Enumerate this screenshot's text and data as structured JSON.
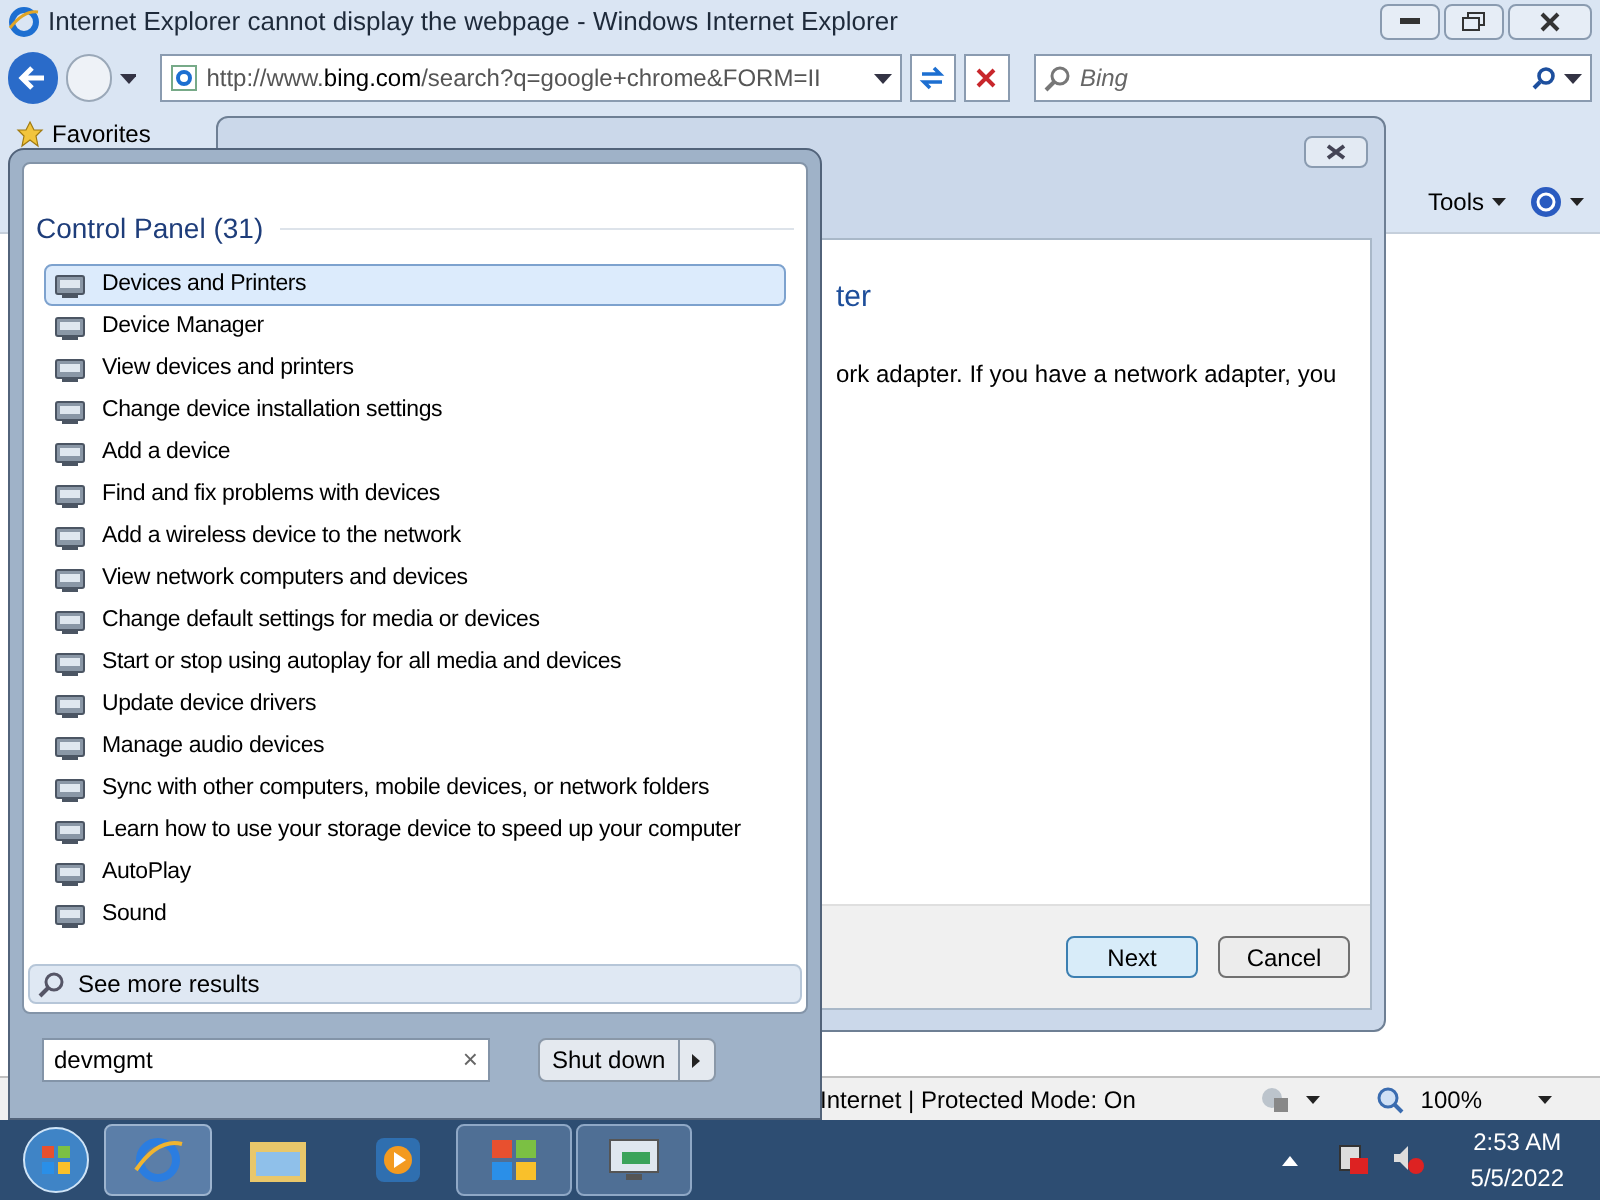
{
  "window": {
    "title": "Internet Explorer cannot display the webpage - Windows Internet Explorer"
  },
  "address_bar": {
    "url_prefix": "http://www.",
    "url_domain": "bing.com",
    "url_rest": "/search?q=google+chrome&FORM=II"
  },
  "search_box": {
    "placeholder": "Bing"
  },
  "favorites_bar": {
    "label": "Favorites"
  },
  "command_bar": {
    "tools": "Tools"
  },
  "dialog": {
    "heading": "ter",
    "text": "ork adapter. If you have a network adapter, you",
    "buttons": [
      {
        "label": "Next",
        "default": true
      },
      {
        "label": "Cancel",
        "default": false
      }
    ]
  },
  "status_bar": {
    "zone": "Internet | Protected Mode: On",
    "zoom": "100%"
  },
  "start_menu": {
    "group": "Control Panel (31)",
    "results": [
      {
        "label": "Devices and Printers",
        "selected": true
      },
      {
        "label": "Device Manager",
        "selected": false
      },
      {
        "label": "View devices and printers",
        "selected": false
      },
      {
        "label": "Change device installation settings",
        "selected": false
      },
      {
        "label": "Add a device",
        "selected": false
      },
      {
        "label": "Find and fix problems with devices",
        "selected": false
      },
      {
        "label": "Add a wireless device to the network",
        "selected": false
      },
      {
        "label": "View network computers and devices",
        "selected": false
      },
      {
        "label": "Change default settings for media or devices",
        "selected": false
      },
      {
        "label": "Start or stop using autoplay for all media and devices",
        "selected": false
      },
      {
        "label": "Update device drivers",
        "selected": false
      },
      {
        "label": "Manage audio devices",
        "selected": false
      },
      {
        "label": "Sync with other computers, mobile devices, or network folders",
        "selected": false
      },
      {
        "label": "Learn how to use your storage device to speed up your computer",
        "selected": false
      },
      {
        "label": "AutoPlay",
        "selected": false
      },
      {
        "label": "Sound",
        "selected": false
      }
    ],
    "see_more": "See more results",
    "search_value": "devmgmt",
    "clear": "×",
    "shutdown": "Shut down"
  },
  "taskbar": {
    "time": "2:53 AM",
    "date": "5/5/2022"
  }
}
